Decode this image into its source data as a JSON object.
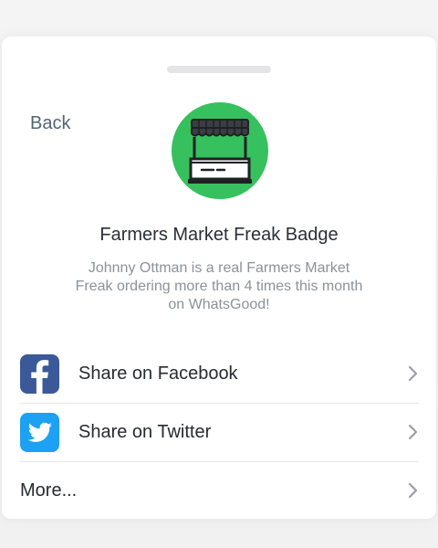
{
  "nav": {
    "back_label": "Back"
  },
  "badge": {
    "icon": "market-stall-icon",
    "title": "Farmers Market Freak Badge",
    "description": "Johnny Ottman is a real Farmers Market Freak ordering more than 4 times this month on WhatsGood!",
    "circle_color": "#36c15e"
  },
  "share": {
    "items": [
      {
        "label": "Share on Facebook",
        "icon": "facebook-icon",
        "color": "#3b5998"
      },
      {
        "label": "Share on Twitter",
        "icon": "twitter-icon",
        "color": "#1da1f2"
      },
      {
        "label": "More...",
        "icon": ""
      }
    ]
  }
}
